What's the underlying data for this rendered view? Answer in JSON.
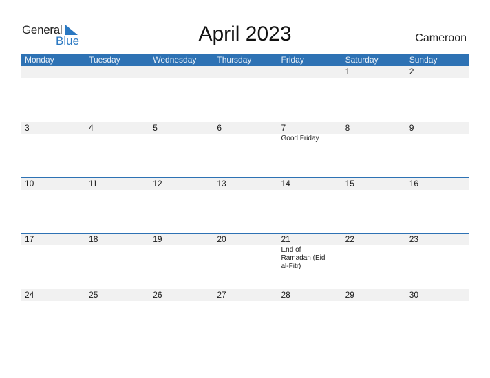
{
  "logo": {
    "line1": "General",
    "line2": "Blue",
    "icon": "triangle-flag-icon"
  },
  "title": "April 2023",
  "country": "Cameroon",
  "colors": {
    "accent": "#2e72b4",
    "day_strip": "#f1f1f1",
    "logo_blue": "#2a78c2"
  },
  "weekdays": [
    "Monday",
    "Tuesday",
    "Wednesday",
    "Thursday",
    "Friday",
    "Saturday",
    "Sunday"
  ],
  "weeks": [
    {
      "days": [
        {
          "num": "",
          "event": ""
        },
        {
          "num": "",
          "event": ""
        },
        {
          "num": "",
          "event": ""
        },
        {
          "num": "",
          "event": ""
        },
        {
          "num": "",
          "event": ""
        },
        {
          "num": "1",
          "event": ""
        },
        {
          "num": "2",
          "event": ""
        }
      ]
    },
    {
      "days": [
        {
          "num": "3",
          "event": ""
        },
        {
          "num": "4",
          "event": ""
        },
        {
          "num": "5",
          "event": ""
        },
        {
          "num": "6",
          "event": ""
        },
        {
          "num": "7",
          "event": "Good Friday"
        },
        {
          "num": "8",
          "event": ""
        },
        {
          "num": "9",
          "event": ""
        }
      ]
    },
    {
      "days": [
        {
          "num": "10",
          "event": ""
        },
        {
          "num": "11",
          "event": ""
        },
        {
          "num": "12",
          "event": ""
        },
        {
          "num": "13",
          "event": ""
        },
        {
          "num": "14",
          "event": ""
        },
        {
          "num": "15",
          "event": ""
        },
        {
          "num": "16",
          "event": ""
        }
      ]
    },
    {
      "days": [
        {
          "num": "17",
          "event": ""
        },
        {
          "num": "18",
          "event": ""
        },
        {
          "num": "19",
          "event": ""
        },
        {
          "num": "20",
          "event": ""
        },
        {
          "num": "21",
          "event": "End of Ramadan (Eid al-Fitr)"
        },
        {
          "num": "22",
          "event": ""
        },
        {
          "num": "23",
          "event": ""
        }
      ]
    },
    {
      "days": [
        {
          "num": "24",
          "event": ""
        },
        {
          "num": "25",
          "event": ""
        },
        {
          "num": "26",
          "event": ""
        },
        {
          "num": "27",
          "event": ""
        },
        {
          "num": "28",
          "event": ""
        },
        {
          "num": "29",
          "event": ""
        },
        {
          "num": "30",
          "event": ""
        }
      ]
    }
  ]
}
